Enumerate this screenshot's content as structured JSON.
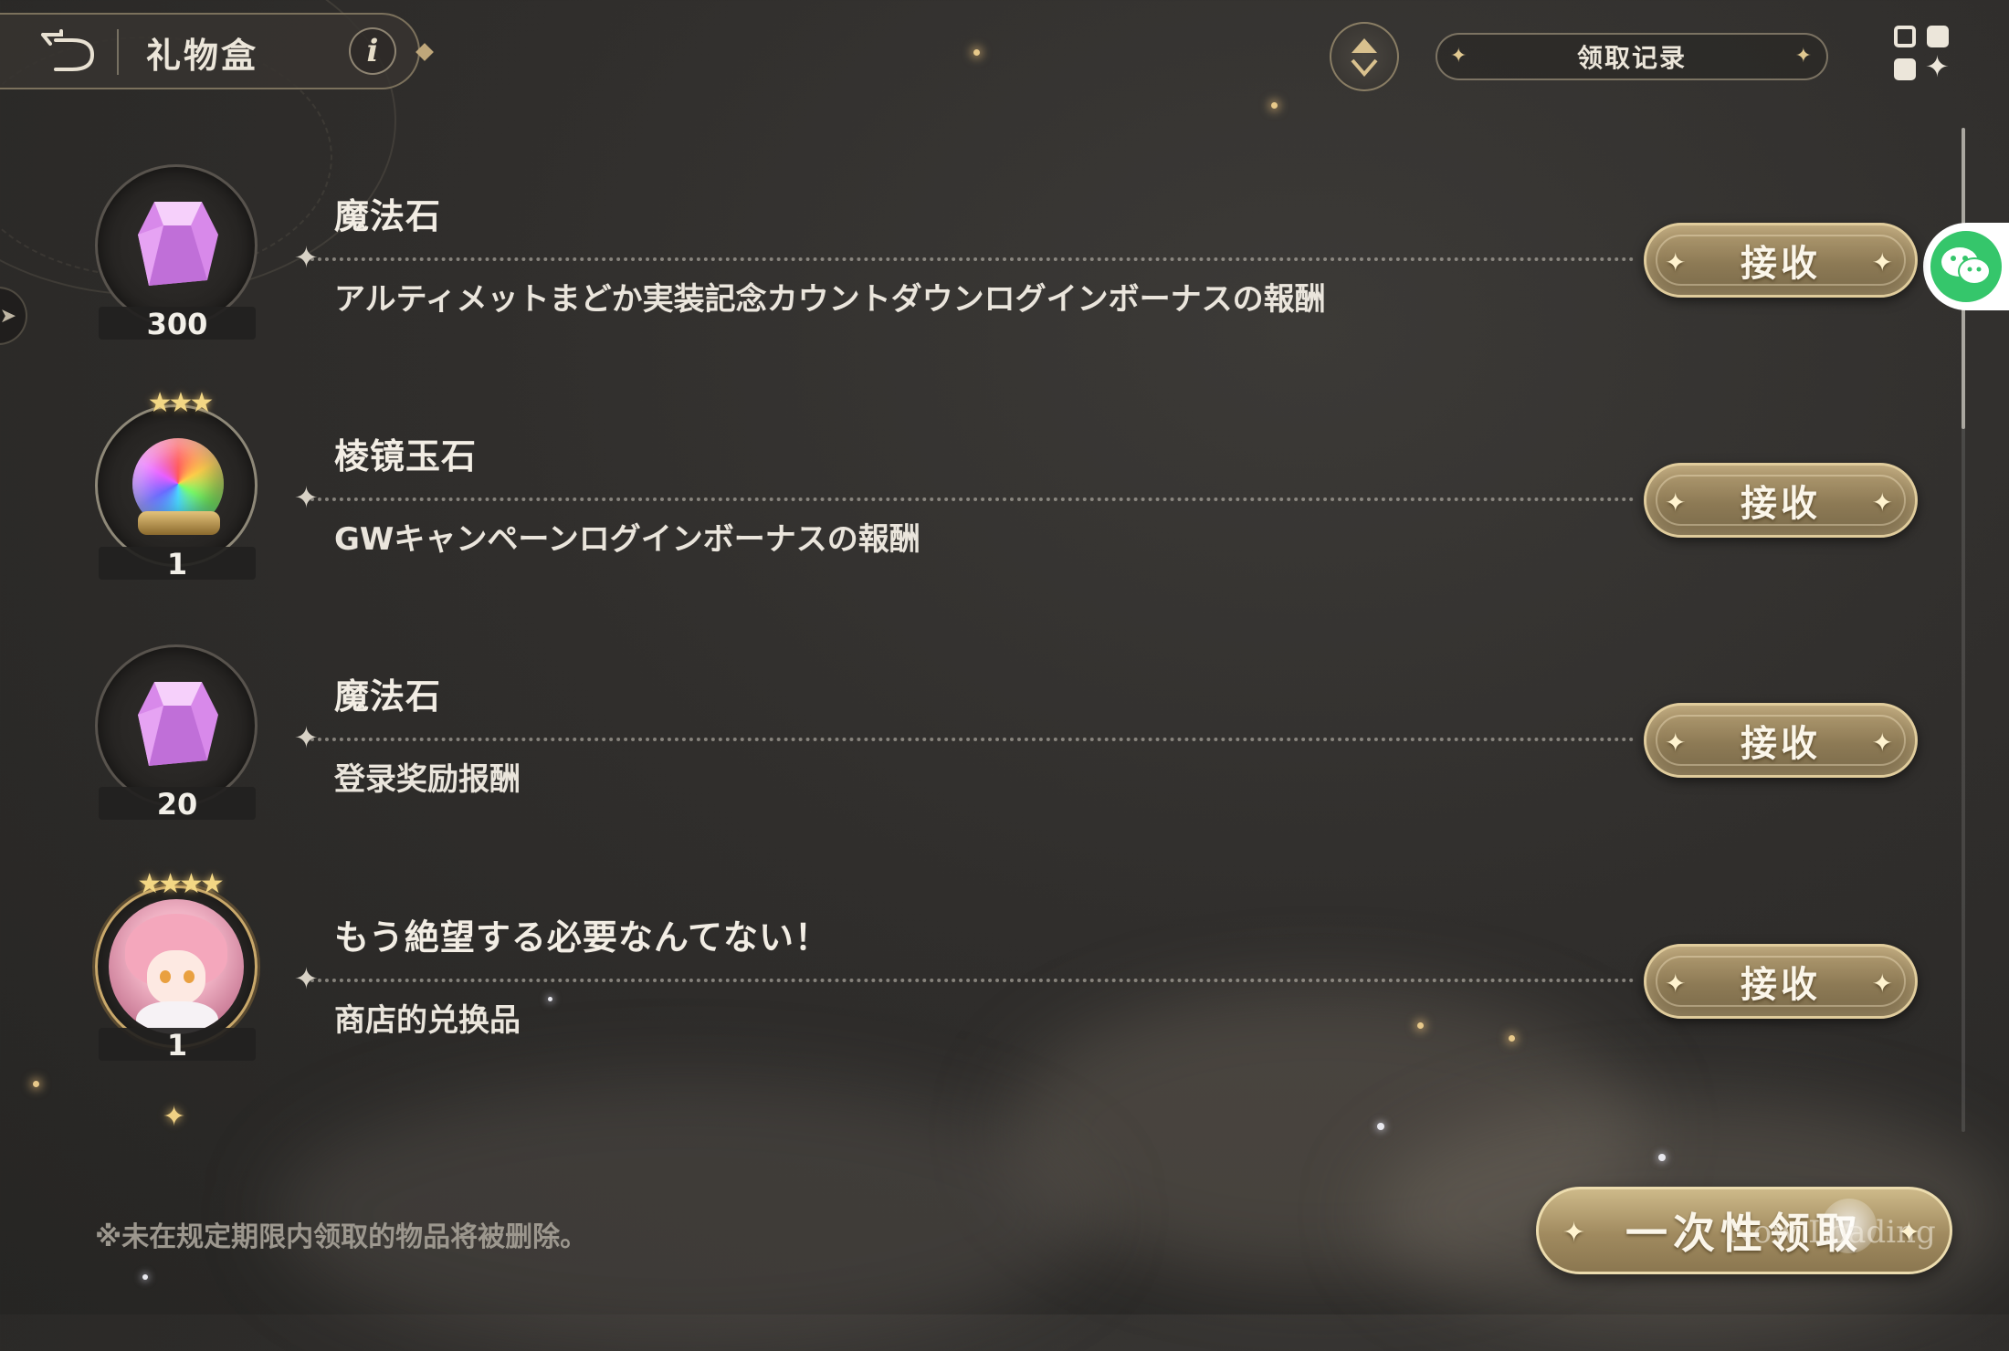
{
  "header": {
    "title": "礼物盒",
    "info_glyph": "i",
    "history_label": "领取记录"
  },
  "gifts": [
    {
      "name": "魔法石",
      "desc": "アルティメットまどか実装記念カウントダウンログインボーナスの報酬",
      "qty": "300",
      "icon": "magic-stone-gem-icon",
      "stars": "",
      "receive_label": "接收"
    },
    {
      "name": "棱镜玉石",
      "desc": "GWキャンペーンログインボーナスの報酬",
      "qty": "1",
      "icon": "prism-orb-icon",
      "stars": "★★★",
      "receive_label": "接收"
    },
    {
      "name": "魔法石",
      "desc": "登录奖励报酬",
      "qty": "20",
      "icon": "magic-stone-gem-icon",
      "stars": "",
      "receive_label": "接收"
    },
    {
      "name": "もう絶望する必要なんてない！",
      "desc": "商店的兑换品",
      "qty": "1",
      "icon": "character-portrait-icon",
      "stars": "★★★★",
      "receive_label": "接收"
    }
  ],
  "footer": {
    "note": "※未在规定期限内领取的物品将被删除。",
    "claim_all_label": "一次性领取",
    "overlay_text": "Now Loading"
  },
  "colors": {
    "background": "#302e2c",
    "gold_accent": "#e0cc9c",
    "button_fill": "#9c885f",
    "wechat_green": "#35c66b"
  }
}
